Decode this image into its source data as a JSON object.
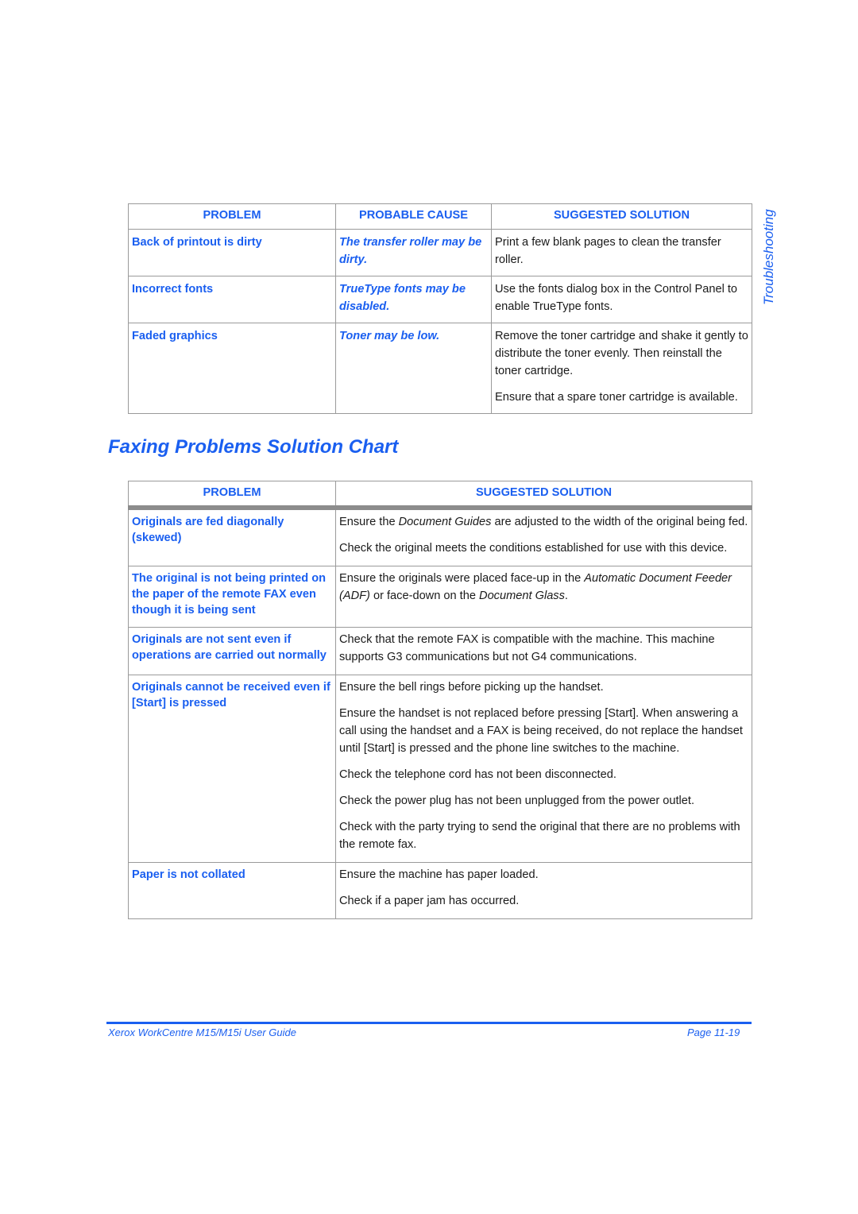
{
  "side_label": "Troubleshooting",
  "table1": {
    "headers": [
      "PROBLEM",
      "PROBABLE CAUSE",
      "SUGGESTED SOLUTION"
    ],
    "rows": [
      {
        "problem": "Back of printout is dirty",
        "cause": "The transfer roller may be dirty.",
        "solutions": [
          "Print a few blank pages to clean the transfer roller."
        ]
      },
      {
        "problem": "Incorrect fonts",
        "cause": "TrueType fonts may be disabled.",
        "solutions": [
          "Use the fonts dialog box in the Control Panel to enable TrueType fonts."
        ]
      },
      {
        "problem": "Faded graphics",
        "cause": "Toner may be low.",
        "solutions": [
          "Remove the toner cartridge and shake it gently to distribute the toner evenly. Then reinstall the toner cartridge.",
          "Ensure that a spare toner cartridge is available."
        ]
      }
    ]
  },
  "section_title": "Faxing Problems Solution Chart",
  "table2": {
    "headers": [
      "PROBLEM",
      "SUGGESTED SOLUTION"
    ],
    "rows": [
      {
        "problem": "Originals are fed diagonally (skewed)",
        "solutions": [
          [
            "Ensure the ",
            "Document Guides",
            " are adjusted to the width of the original being fed."
          ],
          [
            "Check the original meets the conditions established for use with this device."
          ]
        ]
      },
      {
        "problem": "The original is not being printed on the paper of the remote FAX even though it is being sent",
        "solutions": [
          [
            "Ensure the originals were placed face-up in the ",
            "Automatic Document Feeder (ADF)",
            " or face-down on the ",
            "Document Glass",
            "."
          ]
        ]
      },
      {
        "problem": "Originals are not sent even if operations are carried out normally",
        "solutions": [
          [
            "Check that the remote FAX is compatible with the machine. This machine supports G3 communications but not G4 communications."
          ]
        ]
      },
      {
        "problem": "Originals cannot be received even if [Start] is pressed",
        "solutions": [
          [
            "Ensure the bell rings before picking up the handset."
          ],
          [
            "Ensure the handset is not replaced before pressing [Start]. When answering a call using the handset and a FAX is being received, do not replace the handset until [Start] is pressed and the phone line switches to the machine."
          ],
          [
            "Check the telephone cord has not been disconnected."
          ],
          [
            "Check the power plug has not been unplugged from the power outlet."
          ],
          [
            "Check with the party trying to send the original that there are no problems with the remote fax."
          ]
        ]
      },
      {
        "problem": "Paper is not collated",
        "solutions": [
          [
            "Ensure the machine has paper loaded."
          ],
          [
            "Check if a paper jam has occurred."
          ]
        ]
      }
    ]
  },
  "footer": {
    "left": "Xerox WorkCentre M15/M15i User Guide",
    "right": "Page 11-19"
  },
  "colors": {
    "accent": "#1a5ff0",
    "border": "#9a9a9a",
    "header_rule": "#8c8c8c"
  }
}
